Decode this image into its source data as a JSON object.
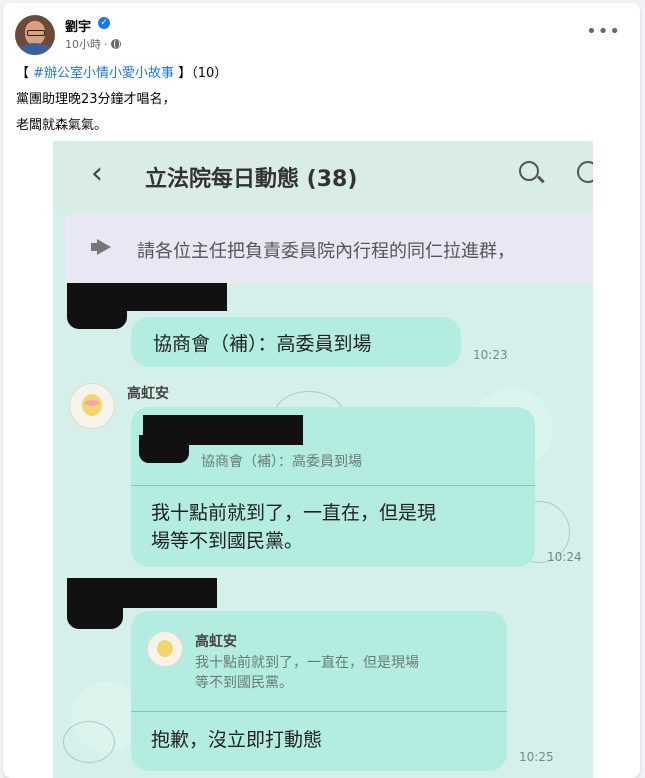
{
  "post": {
    "author": "劉宇",
    "time": "10小時",
    "line1_prefix": "【",
    "hashtag": "#辦公室小情小愛小故事",
    "line1_suffix": "】（10）",
    "line2": "黨團助理晚23分鐘才唱名，",
    "line3": "老闆就森氣氣。",
    "more_icon": "more-horizontal-icon",
    "privacy_icon": "globe-icon",
    "verified_icon": "verified-badge-icon",
    "accent_color": "#1877f2"
  },
  "chat": {
    "title": "立法院每日動態 (38)",
    "announcement": "請各位主任把負責委員院內行程的同仁拉進群，",
    "messages": [
      {
        "text": "協商會（補）：高委員到場",
        "time": "10:23"
      },
      {
        "sender": "高虹安",
        "quote": "協商會（補）：高委員到場",
        "text_line1": "我十點前就到了，一直在，但是現",
        "text_line2": "場等不到國民黨。",
        "time": "10:24"
      },
      {
        "quote_sender": "高虹安",
        "quote_line1": "我十點前就到了，一直在，但是現場",
        "quote_line2": "等不到國民黨。",
        "text": "抱歉，沒立即打動態",
        "time": "10:25"
      }
    ],
    "bubble_color": "#b3ece0",
    "background_color": "#d5f0ea"
  }
}
